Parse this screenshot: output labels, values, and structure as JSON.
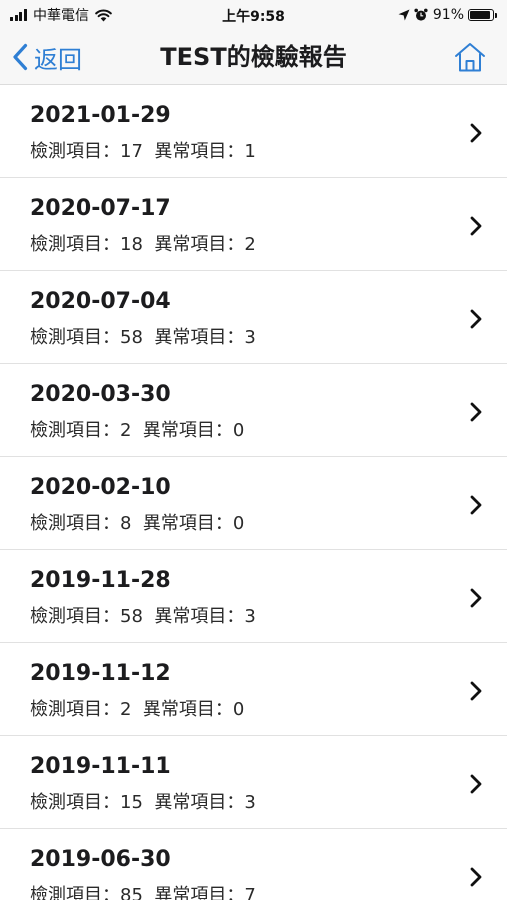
{
  "status_bar": {
    "carrier": "中華電信",
    "time": "上午9:58",
    "battery_percent_text": "91%",
    "battery_level": 0.91
  },
  "nav": {
    "back_label": "返回",
    "title": "TEST的檢驗報告",
    "accent_color": "#2f7fd4"
  },
  "reports": [
    {
      "date": "2021-01-29",
      "summary": "檢測項目：17  異常項目：1"
    },
    {
      "date": "2020-07-17",
      "summary": "檢測項目：18  異常項目：2"
    },
    {
      "date": "2020-07-04",
      "summary": "檢測項目：58  異常項目：3"
    },
    {
      "date": "2020-03-30",
      "summary": "檢測項目：2  異常項目：0"
    },
    {
      "date": "2020-02-10",
      "summary": "檢測項目：8  異常項目：0"
    },
    {
      "date": "2019-11-28",
      "summary": "檢測項目：58  異常項目：3"
    },
    {
      "date": "2019-11-12",
      "summary": "檢測項目：2  異常項目：0"
    },
    {
      "date": "2019-11-11",
      "summary": "檢測項目：15  異常項目：3"
    },
    {
      "date": "2019-06-30",
      "summary": "檢測項目：85  異常項目：7"
    }
  ]
}
